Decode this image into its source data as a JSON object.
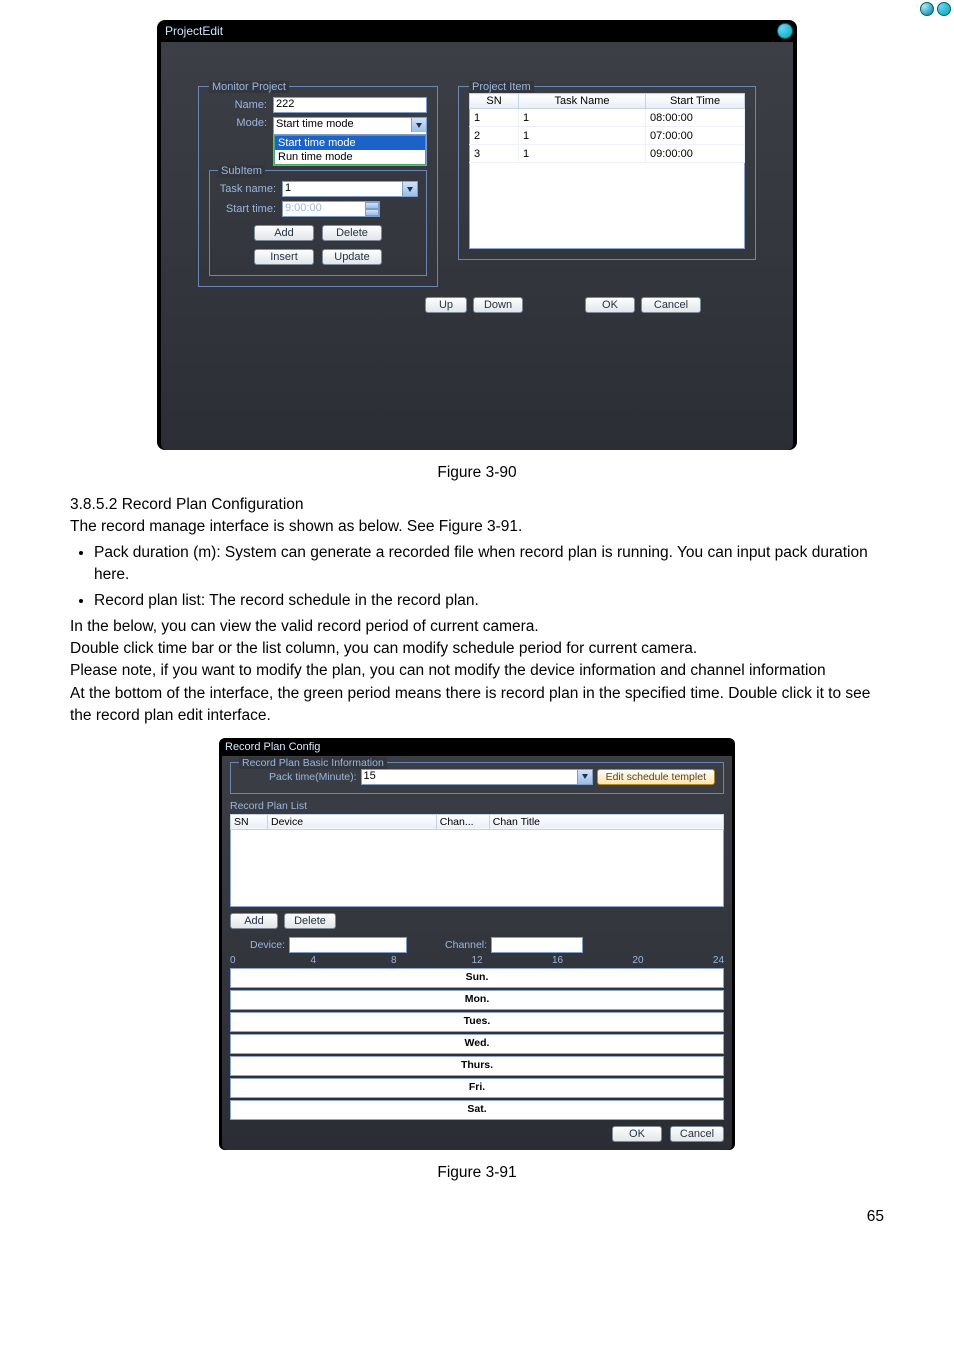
{
  "projectEdit": {
    "title": "ProjectEdit",
    "monitorProjectLegend": "Monitor Project",
    "nameLabel": "Name:",
    "nameValue": "222",
    "modeLabel": "Mode:",
    "modeValue": "Start time mode",
    "modeOptions": [
      "Start time mode",
      "Run time mode"
    ],
    "subItemLegend": "SubItem",
    "taskNameLabel": "Task name:",
    "taskNameValue": "1",
    "startTimeLabel": "Start time:",
    "startTimeValue": "9:00:00",
    "addBtn": "Add",
    "deleteBtn": "Delete",
    "insertBtn": "Insert",
    "updateBtn": "Update",
    "projectItemLegend": "Project Item",
    "headers": [
      "SN",
      "Task Name",
      "Start Time"
    ],
    "rows": [
      {
        "sn": "1",
        "task": "1",
        "time": "08:00:00"
      },
      {
        "sn": "2",
        "task": "1",
        "time": "07:00:00"
      },
      {
        "sn": "3",
        "task": "1",
        "time": "09:00:00"
      }
    ],
    "upBtn": "Up",
    "downBtn": "Down",
    "okBtn": "OK",
    "cancelBtn": "Cancel"
  },
  "fig390": "Figure 3-90",
  "sectionTitle": "3.8.5.2  Record Plan Configuration",
  "p1": "The record manage interface is shown as below. See Figure 3-91.",
  "bullet1": "Pack duration (m): System can generate a recorded file when record plan is running. You can input pack duration here.",
  "bullet2": "Record plan list: The record schedule in the record plan.",
  "p2": "In the below, you can view the valid record period of current camera.",
  "p3": "Double click time bar or the list column, you can modify schedule period for current camera.",
  "p4": "Please note, if you want to modify the plan, you can not modify the device information and channel information",
  "p5": "At the bottom of the interface, the green period means there is record plan in the specified time. Double click it to see the record plan edit interface.",
  "rpc": {
    "title": "Record Plan Config",
    "basicLegend": "Record Plan Basic Information",
    "packLabel": "Pack time(Minute):",
    "packValue": "15",
    "editTemplateBtn": "Edit schedule templet",
    "listLabel": "Record Plan List",
    "headers": [
      "SN",
      "Device",
      "Chan...",
      "Chan Title"
    ],
    "addBtn": "Add",
    "deleteBtn": "Delete",
    "deviceLabel": "Device:",
    "channelLabel": "Channel:",
    "ticks": [
      "0",
      "4",
      "8",
      "12",
      "16",
      "20",
      "24"
    ],
    "days": [
      "Sun.",
      "Mon.",
      "Tues.",
      "Wed.",
      "Thurs.",
      "Fri.",
      "Sat."
    ],
    "okBtn": "OK",
    "cancelBtn": "Cancel"
  },
  "fig391": "Figure 3-91",
  "pageNum": "65"
}
